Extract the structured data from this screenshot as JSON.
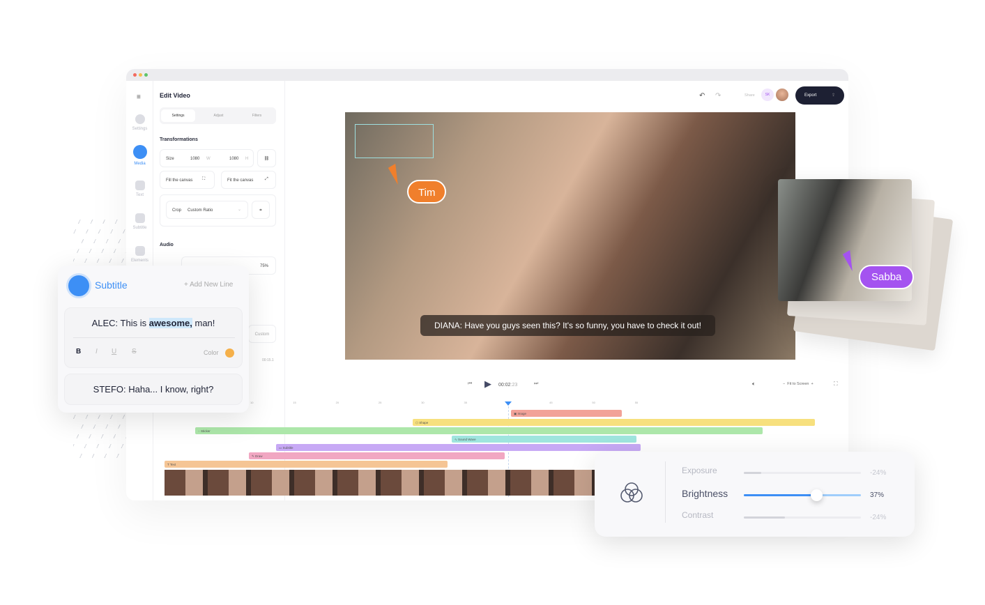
{
  "editor": {
    "title": "Edit Video",
    "tabs": [
      "Settings",
      "Adjust",
      "Filters"
    ],
    "rail": [
      "Settings",
      "Media",
      "Text",
      "Subtitle",
      "Elements"
    ],
    "transformations": {
      "heading": "Transformations",
      "size_label": "Size",
      "width": "1080",
      "w": "W",
      "height": "1080",
      "h": "H",
      "fill": "Fill the canvas",
      "fit": "Fit the canvas",
      "crop_label": "Crop",
      "crop_value": "Custom Ratio"
    },
    "audio": {
      "heading": "Audio",
      "volume": "75%",
      "custom": "Custom",
      "time": "00:15.1"
    }
  },
  "header": {
    "share": "Share",
    "avatar_initials": "SK",
    "export": "Export"
  },
  "video": {
    "caption": "DIANA: Have you guys seen this? It's so funny, you have to check it out!",
    "cursor_tim": "Tim",
    "cursor_sabba": "Sabba"
  },
  "player": {
    "time_main": "00:02",
    "time_frac": ":23",
    "fit": "Fit to Screen"
  },
  "ruler": [
    "10",
    "15",
    "20",
    "25",
    "30",
    "35",
    "40",
    "45",
    "50",
    "55"
  ],
  "tracks": [
    {
      "label": "Image",
      "color": "#f2a298"
    },
    {
      "label": "Shape",
      "color": "#f7e07e"
    },
    {
      "label": "Sticker",
      "color": "#ade7aa"
    },
    {
      "label": "Sound Wave",
      "color": "#9fe5de"
    },
    {
      "label": "Subtitle",
      "color": "#c7a9f5"
    },
    {
      "label": "Draw",
      "color": "#f1a7c2"
    },
    {
      "label": "Text",
      "color": "#f5c595"
    }
  ],
  "subtitle_card": {
    "title": "Subtitle",
    "add": "+ Add New Line",
    "line1_pre": "ALEC: This is ",
    "line1_hl": "awesome,",
    "line1_post": " man!",
    "fmt": [
      "B",
      "I",
      "U",
      "S"
    ],
    "color_label": "Color",
    "color": "#f5b04a",
    "line2": "STEFO: Haha... I know, right?"
  },
  "adjust": {
    "items": [
      {
        "label": "Exposure",
        "value": "-24%",
        "level": 0.15
      },
      {
        "label": "Brightness",
        "value": "37%",
        "level": 0.62
      },
      {
        "label": "Contrast",
        "value": "-24%",
        "level": 0.35
      }
    ]
  },
  "colors": {
    "accent": "#3d8ff5",
    "tim": "#f07f2c",
    "sabba": "#a453f0",
    "export_bg": "#1d2033"
  }
}
